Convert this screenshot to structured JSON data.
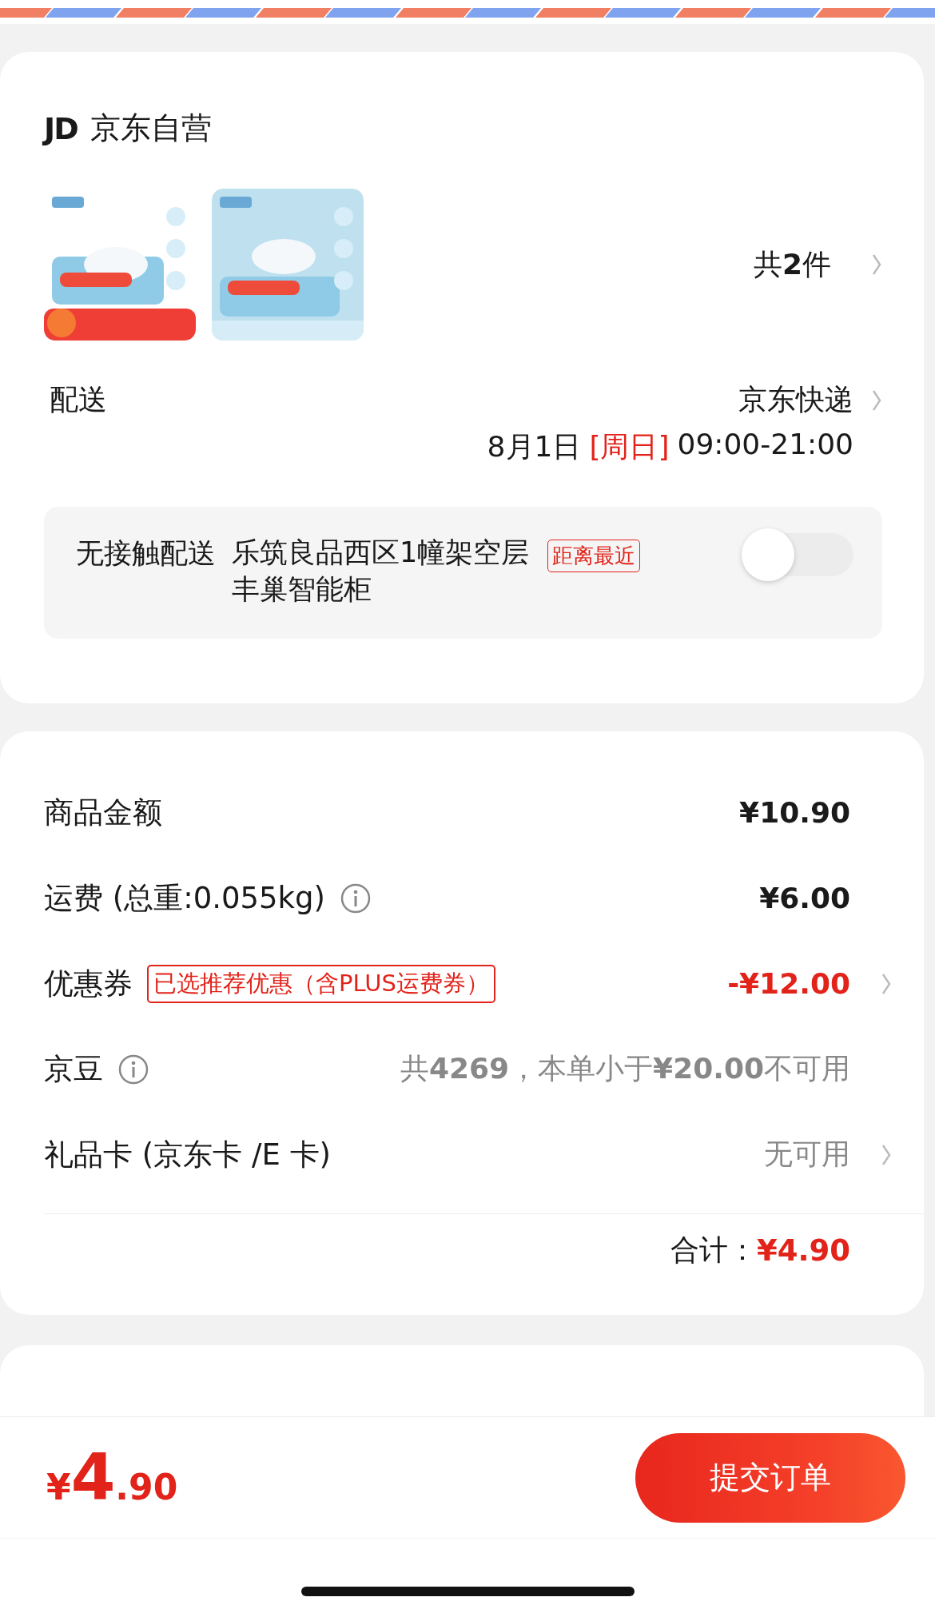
{
  "shop": {
    "badge": "JD",
    "name": "京东自营"
  },
  "item_count": "共**2**件",
  "delivery": {
    "label": "配送",
    "carrier": "京东快递",
    "date": "8月1日",
    "weekday": "[周日]",
    "time": "09:00-21:00"
  },
  "pickup": {
    "label": "无接触配送",
    "address": "乐筑良品西区1幢架空层丰巢智能柜",
    "tag": "距离最近",
    "on": false
  },
  "fees": [
    {
      "label": "商品金额",
      "value": "¥10.90",
      "kind": "amount",
      "info": false,
      "arrow": false
    },
    {
      "label": "运费 (总重:0.055kg)",
      "value": "¥6.00",
      "kind": "amount",
      "info": true,
      "arrow": false
    },
    {
      "label": "优惠券",
      "tag": "已选推荐优惠（含PLUS运费券）",
      "value": "-¥12.00",
      "kind": "discount",
      "info": false,
      "arrow": true
    },
    {
      "label": "京豆",
      "value": "共**4269**，本单小于**¥20.00**不可用",
      "kind": "hint",
      "info": true,
      "arrow": false
    },
    {
      "label": "礼品卡 (京东卡 /E 卡)",
      "value": "无可用",
      "kind": "hint",
      "info": false,
      "arrow": true
    }
  ],
  "total": {
    "label": "合计：",
    "value": "¥4.90"
  },
  "bottom_bar": {
    "currency": "¥",
    "integer": "4",
    "decimal": ".90",
    "submit": "提交订单"
  }
}
